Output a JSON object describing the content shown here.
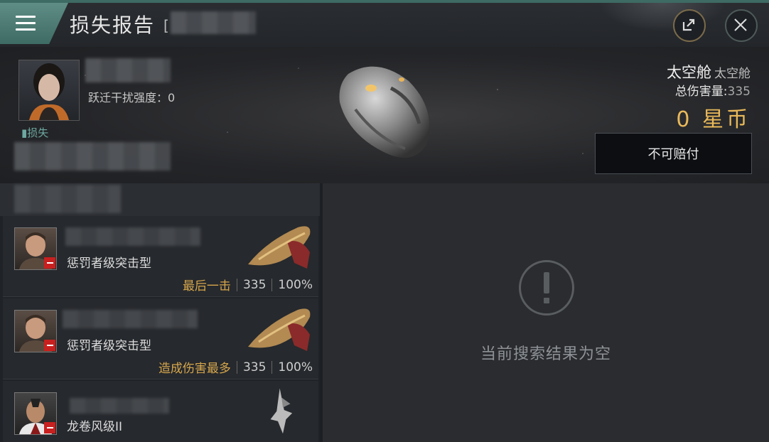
{
  "titlebar": {
    "title": "损失报告",
    "bracket": "[",
    "share_icon": "share-icon",
    "close_icon": "close-icon"
  },
  "victim": {
    "loss_tag": "损失",
    "warp_label": "跃迁干扰强度：0",
    "ship_name": "太空舱",
    "ship_type": "太空舱",
    "damage_label": "总伤害量:",
    "damage_value": "335",
    "isk": "0 星币",
    "compensate_label": "不可赔付"
  },
  "attackers": [
    {
      "ship": "惩罚者级突击型",
      "tag": "最后一击",
      "damage": "335",
      "percent": "100%"
    },
    {
      "ship": "惩罚者级突击型",
      "tag": "造成伤害最多",
      "damage": "335",
      "percent": "100%"
    },
    {
      "ship": "龙卷风级II",
      "tag": "",
      "damage": "",
      "percent": ""
    }
  ],
  "empty": {
    "message": "当前搜索结果为空"
  },
  "colors": {
    "accent": "#3e6b64",
    "gold": "#e9b95a",
    "danger": "#c8201f"
  }
}
